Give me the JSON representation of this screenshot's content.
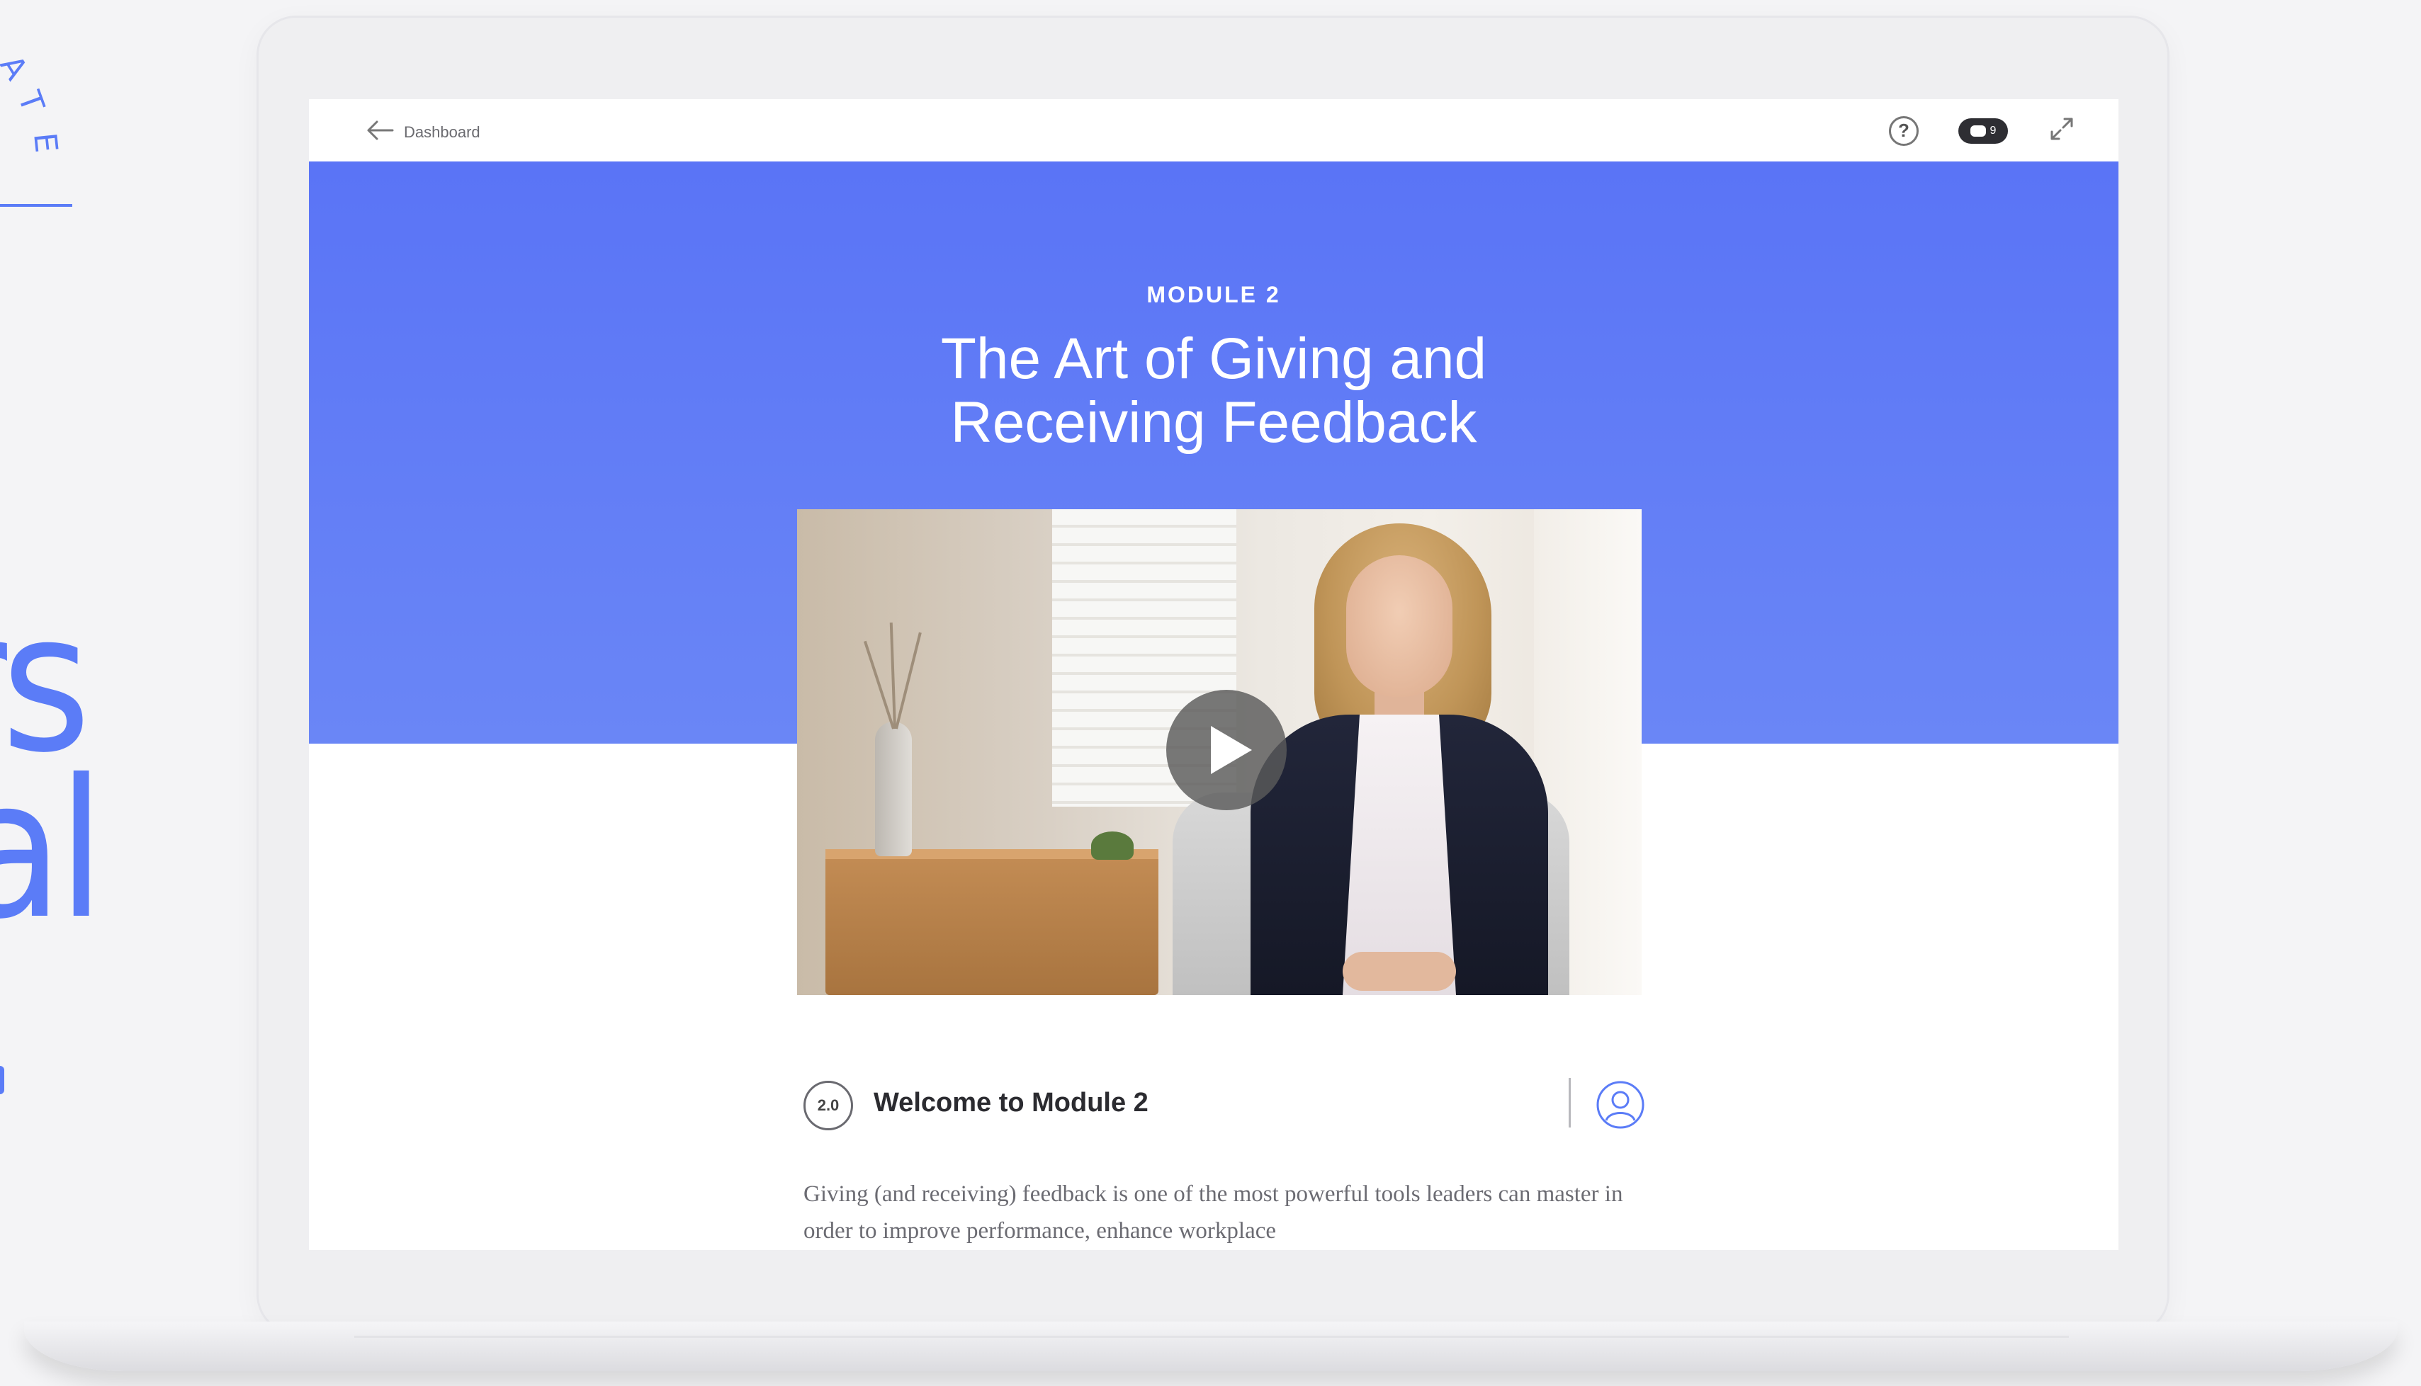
{
  "side_text": {
    "arc_letters": [
      "A",
      "T",
      "E"
    ],
    "big_words": [
      "rs",
      "al"
    ]
  },
  "topbar": {
    "back_label": "Dashboard",
    "chat_count": "9"
  },
  "hero": {
    "module_label": "MODULE 2",
    "title_lines": [
      "The Art of Giving and",
      "Receiving Feedback"
    ]
  },
  "lesson": {
    "number": "2.0",
    "title": "Welcome to Module 2",
    "body": "Giving (and receiving) feedback is one of the most powerful tools leaders can master in order to improve performance, enhance workplace"
  },
  "colors": {
    "accent": "#5b7cf7",
    "hero_bg": "#5a74f6",
    "text_dark": "#2b2b30",
    "text_muted": "#6b6b72"
  },
  "icons": {
    "back": "arrow-left-icon",
    "help": "question-circle-icon",
    "chat": "chat-bubble-icon",
    "expand": "expand-icon",
    "play": "play-icon",
    "avatar": "user-circle-icon"
  }
}
